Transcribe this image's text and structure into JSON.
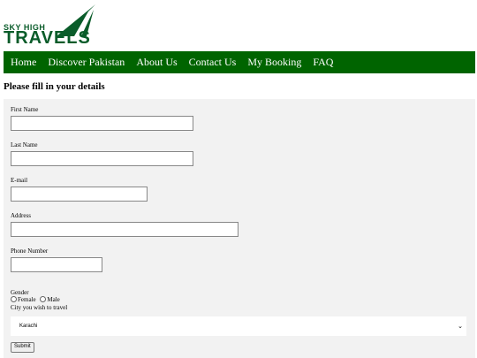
{
  "logo": {
    "small": "SKY HIGH",
    "big": "TRAVELS"
  },
  "nav": {
    "items": [
      "Home",
      "Discover Pakistan",
      "About Us",
      "Contact Us",
      "My Booking",
      "FAQ"
    ]
  },
  "form": {
    "title": "Please fill in your details",
    "first_name_label": "First Name",
    "last_name_label": "Last Name",
    "email_label": "E-mail",
    "address_label": "Address",
    "phone_label": "Phone Number",
    "gender_label": "Gender",
    "gender_options": [
      "Female",
      "Male"
    ],
    "city_label": "City you wish to travel",
    "city_selected": "Karachi",
    "submit_label": "Submit"
  },
  "colors": {
    "nav_bg": "#006400",
    "logo_green": "#0a5c2a",
    "form_bg": "#f2f2f2"
  }
}
